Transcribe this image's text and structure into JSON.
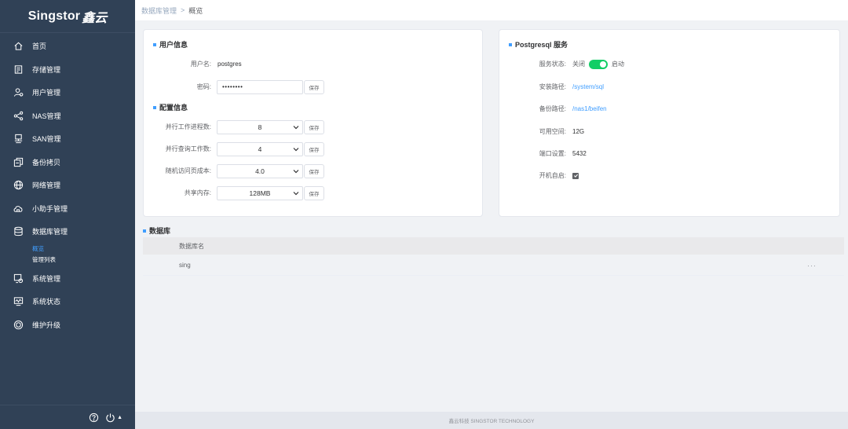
{
  "logo": {
    "text": "Singstor",
    "mark": "鑫云"
  },
  "sidebar": {
    "items": [
      {
        "label": "首页",
        "icon": "home-icon"
      },
      {
        "label": "存储管理",
        "icon": "storage-icon"
      },
      {
        "label": "用户管理",
        "icon": "users-icon"
      },
      {
        "label": "NAS管理",
        "icon": "share-icon"
      },
      {
        "label": "SAN管理",
        "icon": "server-icon"
      },
      {
        "label": "备份拷贝",
        "icon": "copy-icon"
      },
      {
        "label": "网络管理",
        "icon": "globe-icon"
      },
      {
        "label": "小助手管理",
        "icon": "cloud-icon"
      },
      {
        "label": "数据库管理",
        "icon": "database-icon"
      },
      {
        "label": "系统管理",
        "icon": "system-icon"
      },
      {
        "label": "系统状态",
        "icon": "monitor-icon"
      },
      {
        "label": "维护升级",
        "icon": "maintenance-icon"
      }
    ],
    "db_sub": [
      {
        "label": "概览",
        "active": true
      },
      {
        "label": "管理列表",
        "active": false
      }
    ]
  },
  "breadcrumb": {
    "parent": "数据库管理",
    "separator": ">",
    "current": "概览"
  },
  "user_info": {
    "title": "用户信息",
    "username_label": "用户名:",
    "username": "postgres",
    "password_label": "密码:",
    "password": "••••••••",
    "save": "保存"
  },
  "config_info": {
    "title": "配置信息",
    "save": "保存",
    "rows": [
      {
        "label": "并行工作进程数:",
        "value": "8"
      },
      {
        "label": "并行查询工作数:",
        "value": "4"
      },
      {
        "label": "随机访问页成本:",
        "value": "4.0"
      },
      {
        "label": "共享内存:",
        "value": "128MB"
      }
    ]
  },
  "postgres": {
    "title": "Postgresql 服务",
    "status_label": "服务状态:",
    "off_label": "关闭",
    "on_label": "启动",
    "install_label": "安装路径:",
    "install_path": "/system/sql",
    "backup_label": "备份路径:",
    "backup_path": "/nas1/beifen",
    "space_label": "可用空间:",
    "space": "12G",
    "port_label": "端口设置:",
    "port": "5432",
    "autostart_label": "开机自启:"
  },
  "database": {
    "title": "数据库",
    "column": "数据库名",
    "rows": [
      {
        "name": "sing",
        "action": "···"
      }
    ]
  },
  "footer": "鑫云科技 SINGSTOR TECHNOLOGY",
  "colors": {
    "sidebar": "#304156",
    "accent": "#409eff",
    "switch_on": "#13ce66"
  }
}
